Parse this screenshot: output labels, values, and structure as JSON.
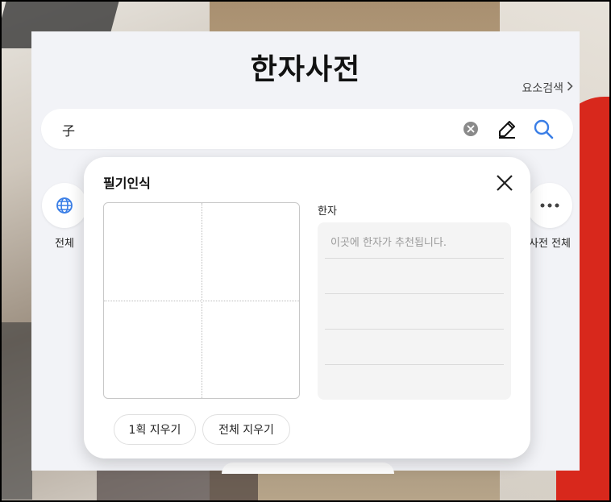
{
  "app": {
    "title": "한자사전",
    "element_search": "요소검색"
  },
  "search": {
    "value": "子"
  },
  "categories": [
    {
      "label": "전체",
      "icon": "globe-icon"
    },
    {
      "label": "사전 전체",
      "icon": "more-icon"
    }
  ],
  "handwriting": {
    "title": "필기인식",
    "hanja_label": "한자",
    "placeholder": "이곳에 한자가 추천됩니다.",
    "undo_label": "1획 지우기",
    "clear_label": "전체 지우기"
  },
  "colors": {
    "accent": "#3a7ee6",
    "panel_bg": "#f2f3f7"
  }
}
